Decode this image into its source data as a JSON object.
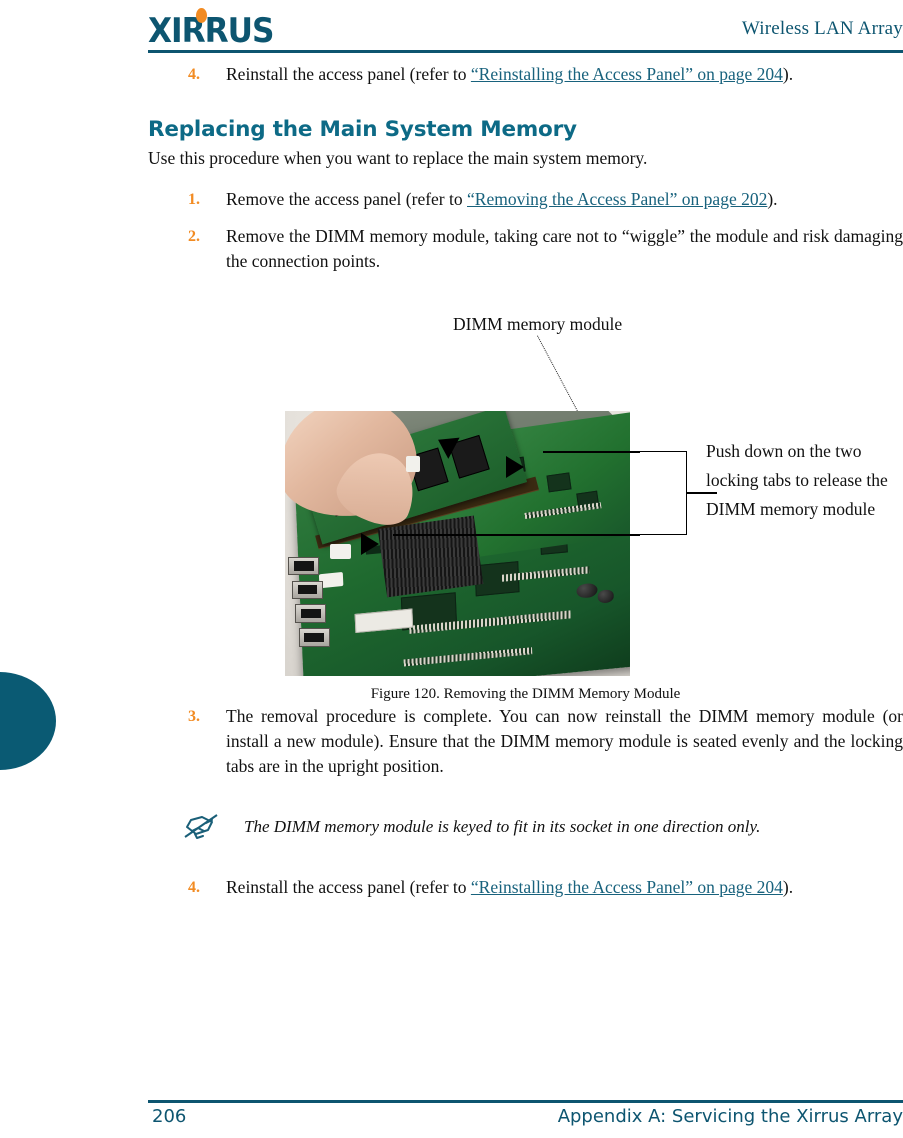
{
  "header": {
    "logo_text": "XIRRUS",
    "logo_dot": "orange-dot",
    "title": "Wireless LAN Array",
    "logo_color": "#0d5570",
    "accent_color": "#f28b22"
  },
  "top_step": {
    "number": "4.",
    "text_before": "Reinstall the access panel (refer to ",
    "link": "“Reinstalling the Access Panel” on page 204",
    "text_after": ")."
  },
  "section": {
    "title": "Replacing the Main System Memory",
    "intro": "Use this procedure when you want to replace the main system memory."
  },
  "steps": [
    {
      "number": "1.",
      "text_before": "Remove the access panel (refer to ",
      "link": "“Removing the Access Panel” on page 202",
      "text_after": ")."
    },
    {
      "number": "2.",
      "text_before": "Remove the DIMM memory module, taking care not to “wiggle” the module and risk damaging the connection points.",
      "link": "",
      "text_after": ""
    }
  ],
  "figure": {
    "top_label": "DIMM memory module",
    "right_callout": "Push down on the two locking tabs to release the DIMM memory module",
    "caption": "Figure 120. Removing the DIMM Memory Module",
    "alt": "Photo of a circuit board with a hand removing a DIMM memory module"
  },
  "step3": {
    "number": "3.",
    "text": "The removal procedure is complete. You can now reinstall the DIMM memory module (or install a new module). Ensure that the DIMM memory module is seated evenly and the locking tabs are in the upright position."
  },
  "note": {
    "icon": "note-pencil-icon",
    "text": "The DIMM memory module is keyed to fit in its socket in one direction only."
  },
  "bottom_step": {
    "number": "4.",
    "text_before": "Reinstall the access panel (refer to ",
    "link": "“Reinstalling the Access Panel” on page 204",
    "text_after": ")."
  },
  "footer": {
    "page_number": "206",
    "section_title": "Appendix A: Servicing the Xirrus Array",
    "color": "#0d5570"
  }
}
